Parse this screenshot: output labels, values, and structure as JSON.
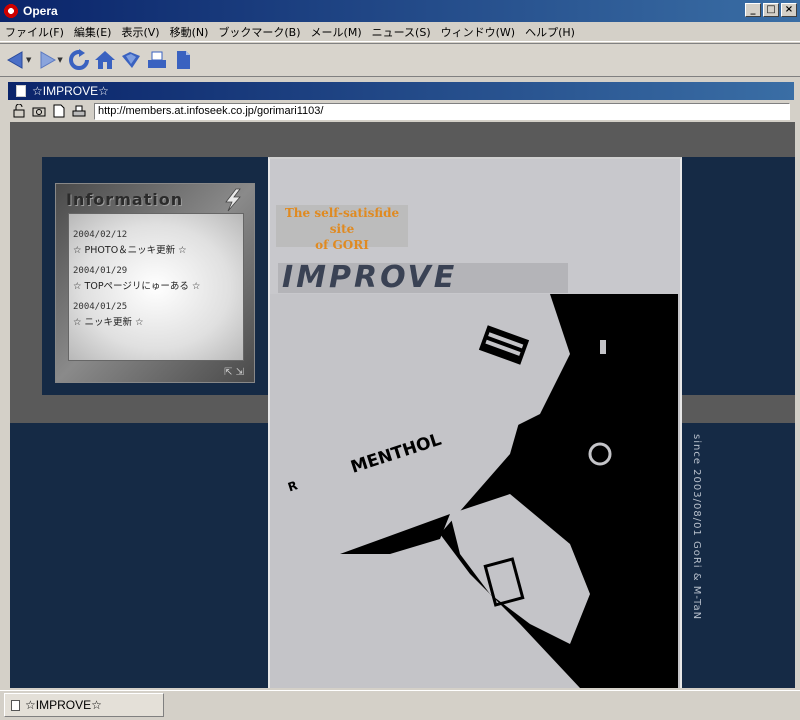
{
  "window": {
    "title": "Opera"
  },
  "menubar": {
    "items": [
      "ファイル(F)",
      "編集(E)",
      "表示(V)",
      "移動(N)",
      "ブックマーク(B)",
      "メール(M)",
      "ニュース(S)",
      "ウィンドウ(W)",
      "ヘルプ(H)"
    ]
  },
  "toolbar": {
    "icons": [
      "back-icon",
      "forward-icon",
      "reload-icon",
      "home-icon",
      "hotlist-icon",
      "print-icon",
      "page-icon"
    ]
  },
  "document": {
    "tab_title": "☆IMPROVE☆"
  },
  "address": {
    "url": "http://members.at.infoseek.co.jp/gorimari1103/"
  },
  "page": {
    "info": {
      "title": "Information",
      "news": [
        {
          "date": "2004/02/12",
          "text": "☆ PHOTO＆ニッキ更新 ☆"
        },
        {
          "date": "2004/01/29",
          "text": "☆ TOPページリにゅーある ☆"
        },
        {
          "date": "2004/01/25",
          "text": "☆ ニッキ更新 ☆"
        }
      ]
    },
    "tagline_line1": "The self-satisfide site",
    "tagline_line2": "of GORI",
    "logo": "IMPROVE",
    "photo_text": "MENTHOL",
    "photo_text_left": "R",
    "vertical_note": "since 2003/08/01 GoRi & M-TaN"
  },
  "statusbar": {
    "tab_label": "☆IMPROVE☆"
  },
  "colors": {
    "titlebar": "#0a246a",
    "page_bg": "#152a45",
    "tagline": "#e08a20"
  }
}
